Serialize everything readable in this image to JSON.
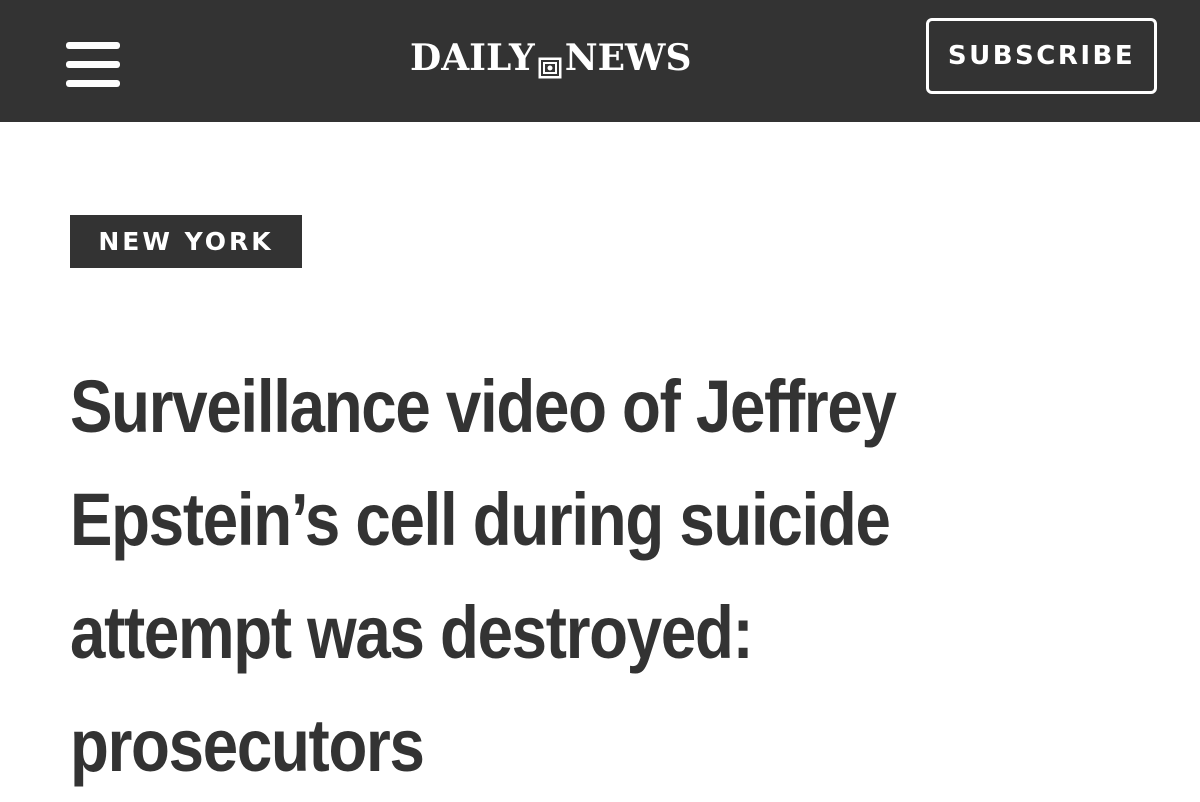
{
  "header": {
    "menu_icon": "hamburger-menu-icon",
    "logo": {
      "left_word": "DAILY",
      "right_word": "NEWS",
      "emblem_icon": "camera-emblem-icon"
    },
    "subscribe_label": "SUBSCRIBE"
  },
  "article": {
    "section": "NEW YORK",
    "headline_lines": [
      "Surveillance video of Jeffrey",
      "Epstein’s cell during suicide",
      "attempt was destroyed:",
      "prosecutors"
    ]
  },
  "colors": {
    "header_bg": "#333333",
    "text_dark": "#333333",
    "on_dark": "#ffffff",
    "page_bg": "#ffffff"
  }
}
